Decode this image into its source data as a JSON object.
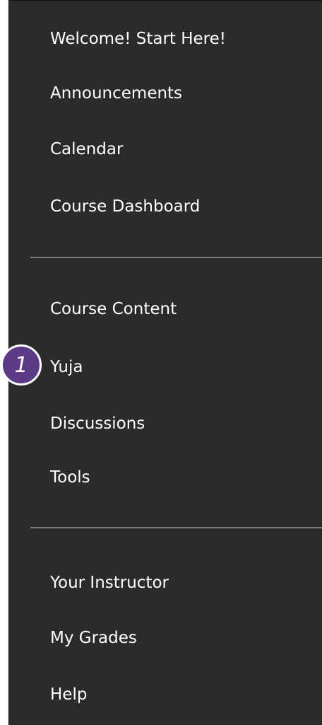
{
  "menu": {
    "group1": [
      {
        "label": "Welcome! Start Here!"
      },
      {
        "label": "Announcements"
      },
      {
        "label": "Calendar"
      },
      {
        "label": "Course Dashboard"
      }
    ],
    "group2": [
      {
        "label": "Course Content"
      },
      {
        "label": "Yuja"
      },
      {
        "label": "Discussions"
      },
      {
        "label": "Tools"
      }
    ],
    "group3": [
      {
        "label": "Your Instructor"
      },
      {
        "label": "My Grades"
      },
      {
        "label": "Help"
      }
    ]
  },
  "annotation": {
    "step_number": "1"
  },
  "colors": {
    "menu_background": "#2b2b2b",
    "text": "#ffffff",
    "divider": "#7a7a7a",
    "badge_fill": "#5c3a86"
  }
}
